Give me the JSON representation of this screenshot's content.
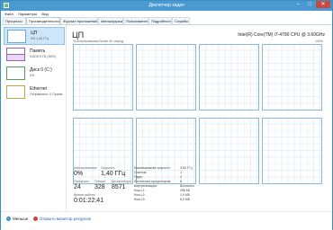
{
  "window": {
    "title": "Диспетчер задач",
    "min": "–",
    "max": "□",
    "close": "✕"
  },
  "menu": [
    "Файл",
    "Параметры",
    "Вид"
  ],
  "tabs": [
    "Процессы",
    "Производительность",
    "Журнал приложений",
    "Автозагрузка",
    "Пользователи",
    "Подробности",
    "Службы"
  ],
  "active_tab": "Производительность",
  "sidebar": [
    {
      "name": "ЦП",
      "sub": "0%  1,40 ГГц",
      "color": "#6ea6d3"
    },
    {
      "name": "Память",
      "sub": "5,8/15,9 ГБ (36%)",
      "color": "#9b5fb6"
    },
    {
      "name": "Диск 0 (C:)",
      "sub": "0%",
      "color": "#4fa352"
    },
    {
      "name": "Ethernet",
      "sub": "Отправлено: 0 Прием",
      "color": "#c9a14a"
    }
  ],
  "main": {
    "title": "ЦП",
    "model": "Intel(R) Core(TM) i7-4790 CPU @ 3.60GHz",
    "chart_label": "% использования более 60 секунд",
    "chart_pct": "100%",
    "stats": {
      "util_label": "Использование",
      "util_value": "0%",
      "speed_label": "Скорость",
      "speed_value": "1,40 ГГц",
      "proc_label": "Процессы",
      "proc_value": "24",
      "threads_label": "Потоки",
      "threads_value": "328",
      "handles_label": "Дескрипторы",
      "handles_value": "8571",
      "uptime_label": "Время работы",
      "uptime_value": "0:01:22:41"
    },
    "specs": [
      {
        "k": "Максимальная скорость:",
        "v": "3,60 ГГц"
      },
      {
        "k": "Сокетов:",
        "v": "1"
      },
      {
        "k": "Ядра:",
        "v": "4"
      },
      {
        "k": "Логических процессоров:",
        "v": "8"
      },
      {
        "k": "Виртуализация:",
        "v": "Включено"
      },
      {
        "k": "Кэш L1:",
        "v": "256 КБ"
      },
      {
        "k": "Кэш L2:",
        "v": "1,0 МБ"
      },
      {
        "k": "Кэш L3:",
        "v": "8,0 МБ"
      }
    ]
  },
  "footer": {
    "less": "Меньше",
    "monitor": "Открыть монитор ресурсов"
  }
}
